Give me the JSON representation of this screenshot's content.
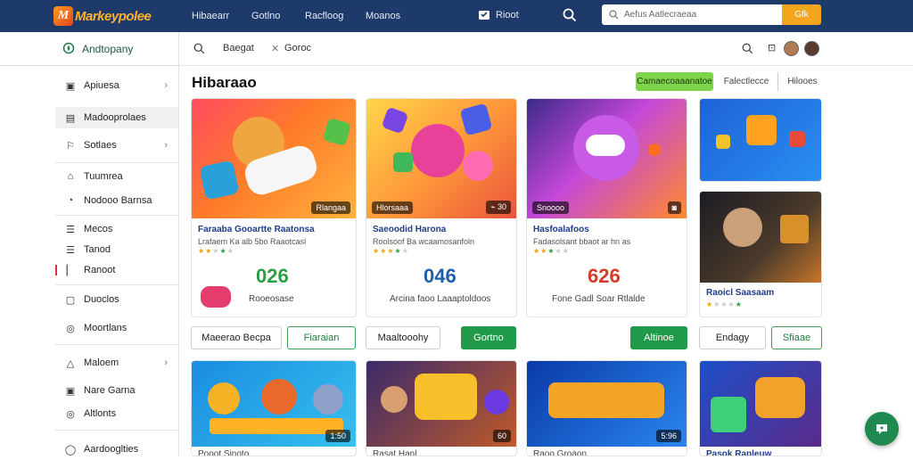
{
  "app": {
    "logo_text": "Markeypolee",
    "logo_mark": "M"
  },
  "topnav": {
    "items": [
      "Hibaearr",
      "Gotlno",
      "Racfloog",
      "Moanos"
    ],
    "cart_label": "Rioot",
    "search_placeholder": "Aefus Aatlecraeaa",
    "search_button": "Gfk"
  },
  "sidebar": {
    "header": "Andtopany",
    "items": [
      {
        "label": "Apiuesa",
        "icon": "gift-icon",
        "chevron": true
      },
      {
        "label": "Madooprolaes",
        "icon": "bag-icon",
        "chevron": false
      },
      {
        "label": "Sotlaes",
        "icon": "flag-icon",
        "chevron": true
      },
      {
        "label": "Tuumrea",
        "icon": "tag-icon",
        "chevron": false
      },
      {
        "label": "Nodooo Barnsa",
        "icon": "tag-icon",
        "chevron": false
      },
      {
        "label": "Mecos",
        "icon": "list-icon",
        "chevron": false
      },
      {
        "label": "Tanod",
        "icon": "list-icon",
        "chevron": false
      },
      {
        "label": "Ranoot",
        "icon": "marker-icon",
        "chevron": false
      },
      {
        "label": "Duoclos",
        "icon": "box-icon",
        "chevron": false
      },
      {
        "label": "Moortlans",
        "icon": "circle-icon",
        "chevron": false
      },
      {
        "label": "Maloem",
        "icon": "triangle-icon",
        "chevron": true
      },
      {
        "label": "Nare Garna",
        "icon": "box-icon",
        "chevron": false
      },
      {
        "label": "Altlonts",
        "icon": "circle-icon",
        "chevron": false
      },
      {
        "label": "Aardooglties",
        "icon": "circle-icon",
        "chevron": false
      }
    ]
  },
  "subbar": {
    "crumb1": "Baegat",
    "crumb2": "Goroc"
  },
  "page": {
    "title": "Hibaraao",
    "filters": {
      "primary": "Camaecoaaanatoe",
      "secondary": "Falectlecce",
      "tertiary": "Hilooes"
    }
  },
  "cards": [
    {
      "tag": "Rlangaa",
      "title": "Faraaba Gooartte Raatonsa",
      "sub": "Lrafaem Ka alb 5bo Raaotcasl",
      "value": "026",
      "value_color": "#2e9e44",
      "caption": "Rooeosase"
    },
    {
      "tag": "Hlorsaaa",
      "title": "Saeoodid Harona",
      "sub": "Roolsoof Ba wcaamosanfoln",
      "value": "046",
      "value_color": "#1f5fa8",
      "caption": "Arcina faoo Laaaptoldoos"
    },
    {
      "tag": "Snoooo",
      "title": "Hasfoalafoos",
      "sub": "Fadasolsant bbaot ar hn as",
      "value": "626",
      "value_color": "#d23b2a",
      "caption": "Fone Gadl Soar Rtlalde"
    },
    {
      "tag": "",
      "title": "Raoicl Saasaam",
      "sub": "",
      "value": "",
      "value_color": "#333",
      "caption": ""
    }
  ],
  "actions": [
    "Maeerao Becpa",
    "Fiaraian",
    "Maaltooohy",
    "Gortno",
    "Altinoe",
    "Endagy",
    "Sfiaae"
  ],
  "bottom_cards": [
    {
      "tag": "1:50",
      "title": "Pooot Sinoto"
    },
    {
      "tag": "60",
      "title": "Rasat Hanl"
    },
    {
      "tag": "5:96",
      "title": "Raoo Groaon"
    },
    {
      "tag": "",
      "title": "Pasok Rapleuw"
    }
  ],
  "colors": {
    "topbar": "#1d3a6b",
    "accent_orange": "#f4a51c",
    "accent_green": "#1f9a48",
    "primary_filter": "#7ed44a"
  }
}
